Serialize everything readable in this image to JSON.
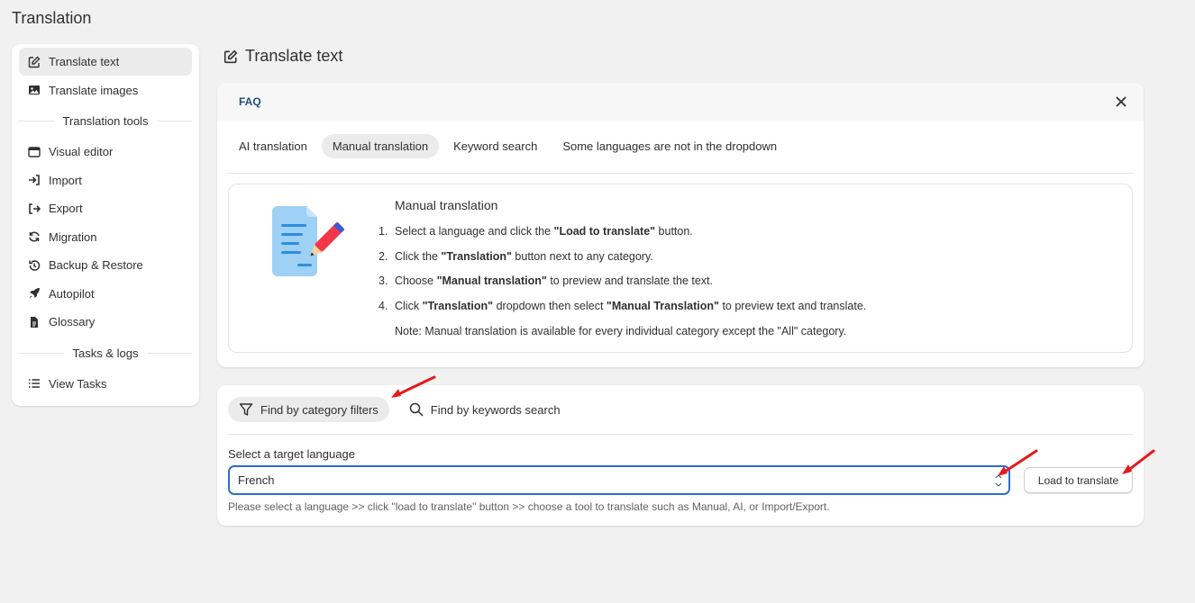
{
  "app": {
    "title": "Translation"
  },
  "sidebar": {
    "items_top": [
      {
        "label": "Translate text",
        "icon": "edit-icon",
        "active": true
      },
      {
        "label": "Translate images",
        "icon": "image-icon",
        "active": false
      }
    ],
    "section_tools": "Translation tools",
    "items_tools": [
      {
        "label": "Visual editor",
        "icon": "browser-window-icon"
      },
      {
        "label": "Import",
        "icon": "import-icon"
      },
      {
        "label": "Export",
        "icon": "export-icon"
      },
      {
        "label": "Migration",
        "icon": "refresh-icon"
      },
      {
        "label": "Backup & Restore",
        "icon": "history-icon"
      },
      {
        "label": "Autopilot",
        "icon": "rocket-icon"
      },
      {
        "label": "Glossary",
        "icon": "document-icon"
      }
    ],
    "section_tasks": "Tasks & logs",
    "items_tasks": [
      {
        "label": "View Tasks",
        "icon": "list-icon"
      }
    ]
  },
  "main": {
    "title": "Translate text",
    "faq": {
      "title": "FAQ",
      "tabs": [
        {
          "label": "AI translation",
          "active": false
        },
        {
          "label": "Manual translation",
          "active": true
        },
        {
          "label": "Keyword search",
          "active": false
        },
        {
          "label": "Some languages are not in the dropdown",
          "active": false
        }
      ],
      "heading": "Manual translation",
      "steps": [
        {
          "num": "1.",
          "pre": "Select a language and click the ",
          "bold": "\"Load to translate\"",
          "post": " button."
        },
        {
          "num": "2.",
          "pre": "Click the ",
          "bold": "\"Translation\"",
          "post": " button next to any category."
        },
        {
          "num": "3.",
          "pre": "Choose ",
          "bold": "\"Manual translation\"",
          "post": " to preview and translate the text."
        },
        {
          "num": "4.",
          "pre": "Click ",
          "bold": "\"Translation\"",
          "mid": " dropdown then select ",
          "bold2": "\"Manual Translation\"",
          "post": " to preview text and translate."
        }
      ],
      "note": "Note: Manual translation is available for every individual category except the \"All\" category."
    },
    "filters": {
      "tabs": [
        {
          "label": "Find by category filters",
          "icon": "filter-icon",
          "active": true
        },
        {
          "label": "Find by keywords search",
          "icon": "search-icon",
          "active": false
        }
      ],
      "language_label": "Select a target language",
      "language_value": "French",
      "load_button": "Load to translate",
      "help": "Please select a language >> click \"load to translate\" button >> choose a tool to translate such as Manual, AI, or Import/Export."
    }
  },
  "colors": {
    "accent": "#2c6ecb",
    "arrow": "#e31b1b",
    "faq_title": "#1f4e79"
  }
}
